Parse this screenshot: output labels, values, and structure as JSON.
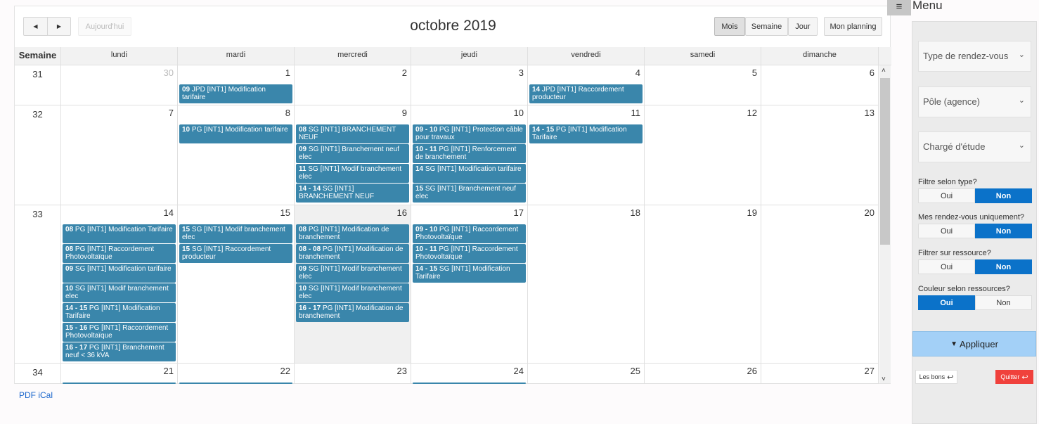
{
  "toolbar": {
    "prev": "◀",
    "next": "▶",
    "today": "Aujourd'hui",
    "title": "octobre 2019",
    "views": [
      "Mois",
      "Semaine",
      "Jour"
    ],
    "active_view": "Mois",
    "planning": "Mon planning"
  },
  "columns": {
    "week": "Semaine",
    "days": [
      "lundi",
      "mardi",
      "mercredi",
      "jeudi",
      "vendredi",
      "samedi",
      "dimanche"
    ]
  },
  "weeks": [
    {
      "num": "31",
      "dates": [
        "30",
        "1",
        "2",
        "3",
        "4",
        "5",
        "6"
      ],
      "other_month": [
        0
      ],
      "events": [
        [],
        [
          {
            "t": "09",
            "d": "JPD [INT1] Modification tarifaire"
          }
        ],
        [],
        [],
        [
          {
            "t": "14",
            "d": "JPD [INT1] Raccordement producteur"
          }
        ],
        [],
        []
      ]
    },
    {
      "num": "32",
      "dates": [
        "7",
        "8",
        "9",
        "10",
        "11",
        "12",
        "13"
      ],
      "events": [
        [],
        [
          {
            "t": "10",
            "d": "PG [INT1] Modification tarifaire"
          }
        ],
        [
          {
            "t": "08",
            "d": "SG [INT1] BRANCHEMENT NEUF"
          },
          {
            "t": "09",
            "d": "SG [INT1] Branchement neuf elec"
          },
          {
            "t": "11",
            "d": "SG [INT1] Modif branchement elec"
          },
          {
            "t": "14 - 14",
            "d": "SG [INT1] BRANCHEMENT NEUF"
          }
        ],
        [
          {
            "t": "09 - 10",
            "d": "PG [INT1] Protection câble pour travaux"
          },
          {
            "t": "10 - 11",
            "d": "PG [INT1] Renforcement de branchement"
          },
          {
            "t": "14",
            "d": "SG [INT1] Modification tarifaire"
          },
          {
            "t": "15",
            "d": "SG [INT1] Branchement neuf elec"
          }
        ],
        [
          {
            "t": "14 - 15",
            "d": "PG [INT1] Modification Tarifaire"
          }
        ],
        [],
        []
      ]
    },
    {
      "num": "33",
      "dates": [
        "14",
        "15",
        "16",
        "17",
        "18",
        "19",
        "20"
      ],
      "today": 2,
      "events": [
        [
          {
            "t": "08",
            "d": "PG [INT1] Modification Tarifaire"
          },
          {
            "t": "08",
            "d": "PG [INT1] Raccordement Photovoltaïque"
          },
          {
            "t": "09",
            "d": "SG [INT1] Modification tarifaire"
          },
          {
            "t": "10",
            "d": "SG [INT1] Modif branchement elec"
          },
          {
            "t": "14 - 15",
            "d": "PG [INT1] Modification Tarifaire"
          },
          {
            "t": "15 - 16",
            "d": "PG [INT1] Raccordement Photovoltaïque"
          },
          {
            "t": "16 - 17",
            "d": "PG [INT1] Branchement neuf < 36 kVA"
          }
        ],
        [
          {
            "t": "15",
            "d": "SG [INT1] Modif branchement elec"
          },
          {
            "t": "15",
            "d": "SG [INT1] Raccordement producteur"
          }
        ],
        [
          {
            "t": "08",
            "d": "PG [INT1] Modification de branchement"
          },
          {
            "t": "08 - 08",
            "d": "PG [INT1] Modification de branchement"
          },
          {
            "t": "09",
            "d": "SG [INT1] Modif branchement elec"
          },
          {
            "t": "10",
            "d": "SG [INT1] Modif branchement elec"
          },
          {
            "t": "16 - 17",
            "d": "PG [INT1] Modification de branchement"
          }
        ],
        [
          {
            "t": "09 - 10",
            "d": "PG [INT1] Raccordement Photovoltaïque"
          },
          {
            "t": "10 - 11",
            "d": "PG [INT1] Raccordement Photovoltaïque"
          },
          {
            "t": "14 - 15",
            "d": "SG [INT1] Modification Tarifaire"
          }
        ],
        [],
        [],
        []
      ]
    },
    {
      "num": "34",
      "dates": [
        "21",
        "22",
        "23",
        "24",
        "25",
        "26",
        "27"
      ],
      "partial": [
        0,
        1,
        3
      ],
      "events": [
        [],
        [],
        [],
        [],
        [],
        [],
        []
      ]
    }
  ],
  "footer": {
    "pdf": "PDF",
    "ical": "iCal"
  },
  "menu": {
    "toggle_icon": "hamburger-icon",
    "title": "Menu",
    "selects": [
      "Type de rendez-vous",
      "Pôle (agence)",
      "Chargé d'étude"
    ],
    "toggles": [
      {
        "label": "Filtre selon type?",
        "value": "Non"
      },
      {
        "label": "Mes rendez-vous uniquement?",
        "value": "Non"
      },
      {
        "label": "Filtrer sur ressource?",
        "value": "Non"
      },
      {
        "label": "Couleur selon ressources?",
        "value": "Oui"
      }
    ],
    "yes": "Oui",
    "no": "Non",
    "apply": "Appliquer",
    "les_bons": "Les bons",
    "quit": "Quitter"
  },
  "colors": {
    "event": "#3a86ab",
    "toggle_on": "#0b72c9",
    "apply": "#a3d0f7",
    "quit": "#f0413c",
    "link": "#1a66cc"
  }
}
